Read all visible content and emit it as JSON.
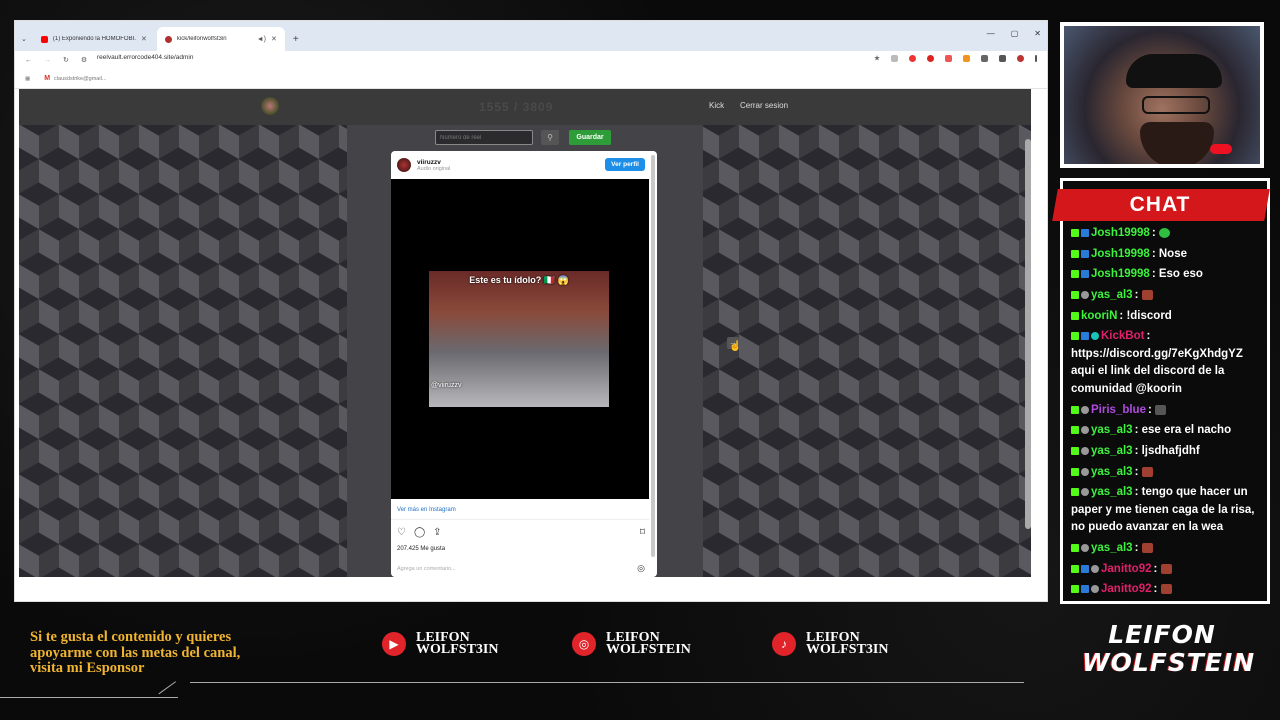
{
  "browser": {
    "tabs": [
      {
        "title": "(1) Exponiendo la HOMOFOBI...",
        "favicon_color": "#ff0000"
      },
      {
        "title": "kick/leifonwolfst3in",
        "favicon_color": "#b03030"
      }
    ],
    "url": "reelvault.errorcode404.site/admin",
    "bookmark_label": "clausdstrike@gmail..."
  },
  "site": {
    "nav_faint_text": "1555 / 3809",
    "nav_links": [
      "Kick",
      "Cerrar sesion"
    ],
    "reel_input_placeholder": "Número de reel",
    "save_label": "Guardar",
    "left_arrow": "←",
    "right_arrow": "→"
  },
  "instagram": {
    "username": "viiruzzv",
    "audio": "Audio original",
    "follow_label": "Ver perfil",
    "caption_overlay": "Este es tu ídolo? 🇮🇹 😱",
    "video_handle": "@viiruzzv",
    "more_link": "Ver más en Instagram",
    "likes": "207.425 Me gusta",
    "comment_placeholder": "Agrega un comentario..."
  },
  "chat": {
    "title": "CHAT",
    "messages": [
      {
        "user": "Josh19998",
        "color": "#3df33d",
        "badges": [
          "kick",
          "blue"
        ],
        "text": "",
        "emote": "em-green"
      },
      {
        "user": "Josh19998",
        "color": "#3df33d",
        "badges": [
          "kick",
          "blue"
        ],
        "text": "Nose",
        "emote": ""
      },
      {
        "user": "Josh19998",
        "color": "#3df33d",
        "badges": [
          "kick",
          "blue"
        ],
        "text": "Eso eso",
        "emote": ""
      },
      {
        "user": "yas_al3",
        "color": "#3df33d",
        "badges": [
          "kick",
          "gray"
        ],
        "text": "",
        "emote": "em-red"
      },
      {
        "user": "kooriN",
        "color": "#3df33d",
        "badges": [
          "kick"
        ],
        "text": "!discord",
        "emote": ""
      },
      {
        "user": "KickBot",
        "color": "#e0206a",
        "badges": [
          "kick",
          "blue",
          "teal"
        ],
        "text": "https://discord.gg/7eKgXhdgYZ aqui el link del discord de la comunidad @koorin",
        "emote": ""
      },
      {
        "user": "Piris_blue",
        "color": "#b04ae0",
        "badges": [
          "kick",
          "gray"
        ],
        "text": "",
        "emote": "em-dark"
      },
      {
        "user": "yas_al3",
        "color": "#3df33d",
        "badges": [
          "kick",
          "gray"
        ],
        "text": "ese era el nacho",
        "emote": ""
      },
      {
        "user": "yas_al3",
        "color": "#3df33d",
        "badges": [
          "kick",
          "gray"
        ],
        "text": "ljsdhafjdhf",
        "emote": ""
      },
      {
        "user": "yas_al3",
        "color": "#3df33d",
        "badges": [
          "kick",
          "gray"
        ],
        "text": "",
        "emote": "em-red"
      },
      {
        "user": "yas_al3",
        "color": "#3df33d",
        "badges": [
          "kick",
          "gray"
        ],
        "text": "tengo que hacer un paper y me tienen caga de la risa, no puedo avanzar en la wea",
        "emote": ""
      },
      {
        "user": "yas_al3",
        "color": "#3df33d",
        "badges": [
          "kick",
          "gray"
        ],
        "text": "",
        "emote": "em-red"
      },
      {
        "user": "Janitto92",
        "color": "#e0206a",
        "badges": [
          "kick",
          "blue",
          "gray"
        ],
        "text": "",
        "emote": "em-red"
      },
      {
        "user": "Janitto92",
        "color": "#e0206a",
        "badges": [
          "kick",
          "blue",
          "gray"
        ],
        "text": "",
        "emote": "em-red"
      }
    ]
  },
  "banner": {
    "promo_line1": "Si te gusta el contenido y quieres",
    "promo_line2": "apoyarme con las metas del canal,",
    "promo_line3": "visita mi Esponsor",
    "socials": [
      {
        "icon": "youtube-icon",
        "glyph": "▶",
        "line1": "LEIFON",
        "line2": "WOLFST3IN"
      },
      {
        "icon": "instagram-icon",
        "glyph": "◎",
        "line1": "LEIFON",
        "line2": "WOLFSTEIN"
      },
      {
        "icon": "tiktok-icon",
        "glyph": "♪",
        "line1": "LEIFON",
        "line2": "WOLFST3IN"
      }
    ],
    "logo_line1": "LEIFON",
    "logo_line2": "WOLFSTEIN"
  },
  "colors": {
    "accent_red": "#d3171a",
    "promo_gold": "#f0b430",
    "kick_green": "#53fc18",
    "save_green": "#2e9d39"
  }
}
